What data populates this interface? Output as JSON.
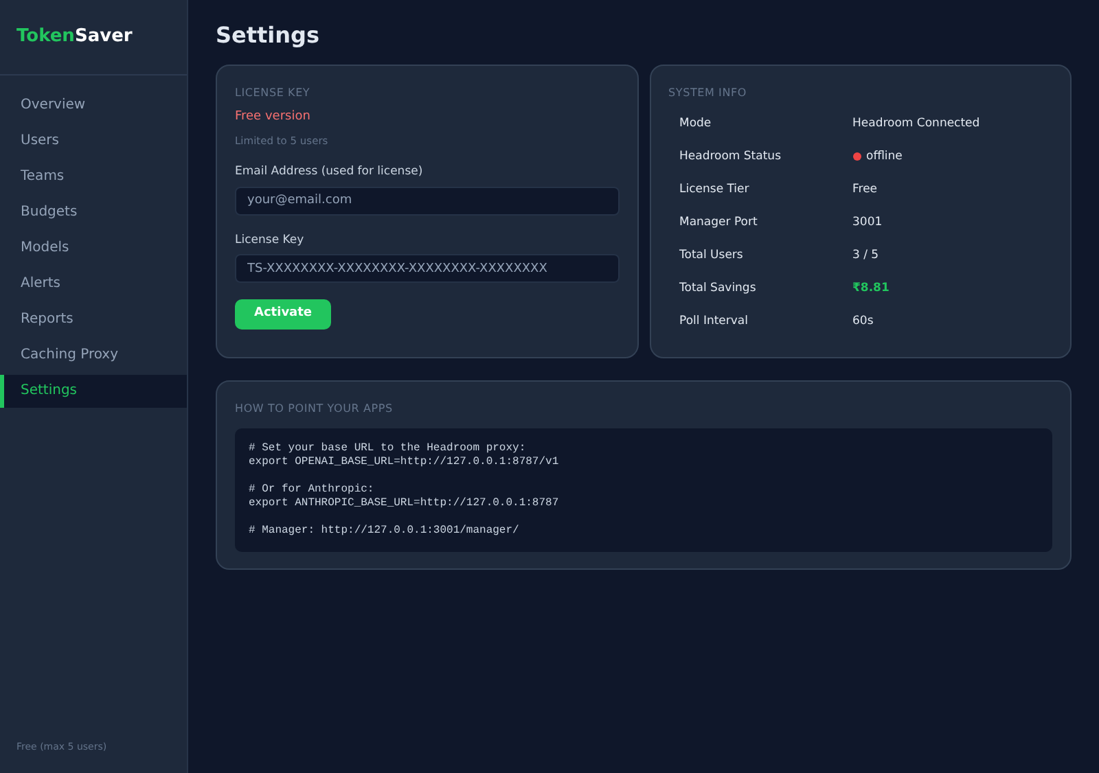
{
  "sidebar": {
    "logo": {
      "part_1": "Token",
      "part_2": "Saver"
    },
    "items": [
      {
        "label": "Overview",
        "selected": false
      },
      {
        "label": "Users",
        "selected": false
      },
      {
        "label": "Teams",
        "selected": false
      },
      {
        "label": "Budgets",
        "selected": false
      },
      {
        "label": "Models",
        "selected": false
      },
      {
        "label": "Alerts",
        "selected": false
      },
      {
        "label": "Reports",
        "selected": false
      },
      {
        "label": "Caching Proxy",
        "selected": false
      },
      {
        "label": "Settings",
        "selected": true
      }
    ],
    "footer": "Free (max 5 users)"
  },
  "page_title": "Settings",
  "license_card": {
    "title": "LICENSE KEY",
    "status": "Free version",
    "note": "Limited to 5 users",
    "fields": [
      {
        "label": "Email Address (used for license)",
        "placeholder": "your@email.com"
      },
      {
        "label": "License Key",
        "placeholder": "TS-XXXXXXXX-XXXXXXXX-XXXXXXXX-XXXXXXXX"
      }
    ],
    "button": "Activate"
  },
  "system_info": {
    "title": "SYSTEM INFO",
    "rows": [
      {
        "label": "Mode",
        "value": "Headroom Connected",
        "kind": "text"
      },
      {
        "label": "Headroom Status",
        "value": "offline",
        "kind": "status",
        "color": "#ef4444"
      },
      {
        "label": "License Tier",
        "value": "Free",
        "kind": "text"
      },
      {
        "label": "Manager Port",
        "value": "3001",
        "kind": "text"
      },
      {
        "label": "Total Users",
        "value": "3 / 5",
        "kind": "text"
      },
      {
        "label": "Total Savings",
        "value": "₹8.81",
        "kind": "money"
      },
      {
        "label": "Poll Interval",
        "value": "60s",
        "kind": "text"
      }
    ]
  },
  "apps_card": {
    "title": "HOW TO POINT YOUR APPS",
    "code_groups": [
      [
        "# Set your base URL to the Headroom proxy:",
        "export OPENAI_BASE_URL=http://127.0.0.1:8787/v1"
      ],
      [
        "# Or for Anthropic:",
        "export ANTHROPIC_BASE_URL=http://127.0.0.1:8787"
      ],
      [
        "# Manager: http://127.0.0.1:3001/manager/"
      ]
    ]
  }
}
